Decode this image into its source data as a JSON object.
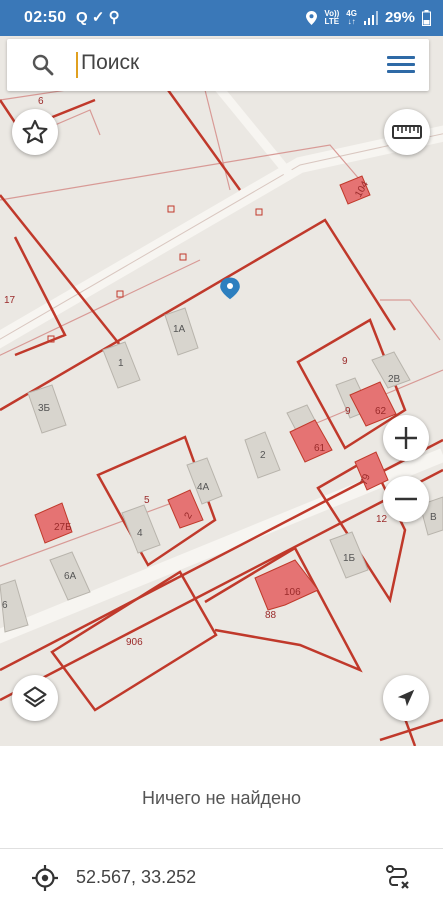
{
  "status_bar": {
    "time": "02:50",
    "left_icons": "Q ✓ ⚲",
    "volte_top": "Vo))",
    "volte_bottom": "LTE",
    "net_top": "4G",
    "net_bottom": "↓↑",
    "battery": "29%"
  },
  "search": {
    "placeholder": "Поиск"
  },
  "map": {
    "plot_labels": [
      "6",
      "104",
      "17",
      "1А",
      "1",
      "3Б",
      "9",
      "2В",
      "9",
      "62",
      "61",
      "2",
      "4А",
      "5",
      "4",
      "2",
      "79",
      "12",
      "27Б",
      "6А",
      "6",
      "1Б",
      "106",
      "88",
      "906",
      "В"
    ]
  },
  "bottom": {
    "empty_message": "Ничего не найдено",
    "coordinates": "52.567, 33.252"
  },
  "colors": {
    "accent": "#2f6aa6",
    "status_bar": "#3a78b8",
    "plot_border": "#c0392b",
    "building": "#e57373"
  }
}
